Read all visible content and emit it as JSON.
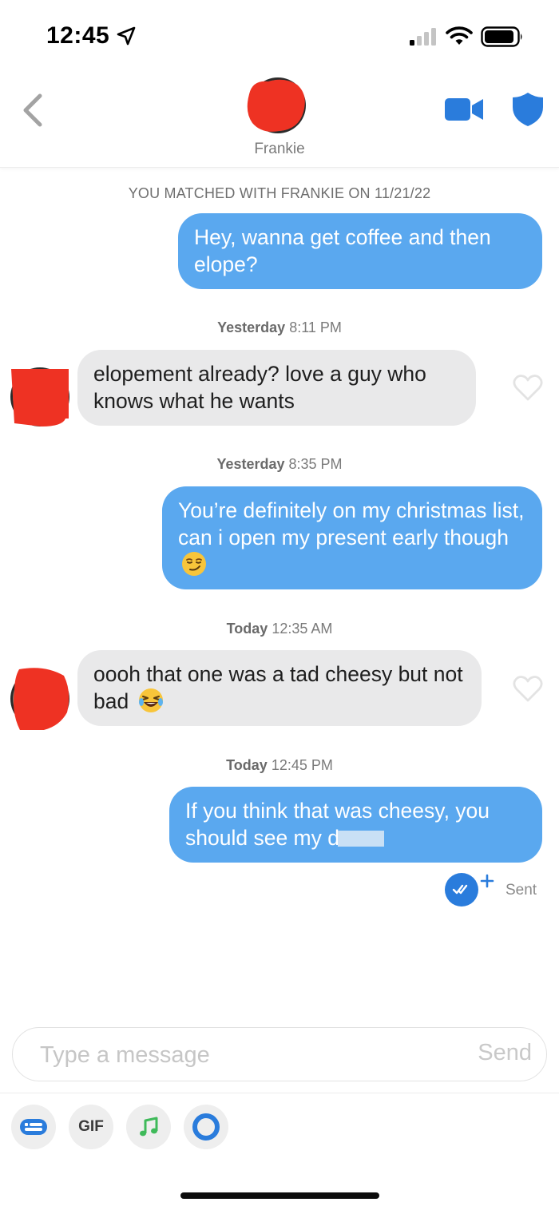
{
  "status_bar": {
    "time": "12:45",
    "icons": [
      "location-arrow-icon",
      "cellular-signal-icon",
      "wifi-icon",
      "battery-icon"
    ]
  },
  "header": {
    "contact_name": "Frankie",
    "icons": [
      "back-chevron-icon",
      "video-camera-icon",
      "shield-icon"
    ],
    "accent_color": "#2a7cdc"
  },
  "conversation": {
    "match_label": "YOU MATCHED WITH FRANKIE ON 11/21/22",
    "timestamps": [
      {
        "day": "Yesterday",
        "time": "8:11 PM"
      },
      {
        "day": "Yesterday",
        "time": "8:35 PM"
      },
      {
        "day": "Today",
        "time": "12:35 AM"
      },
      {
        "day": "Today",
        "time": "12:45 PM"
      }
    ],
    "messages": [
      {
        "direction": "outgoing",
        "text": "Hey, wanna get coffee and then elope?"
      },
      {
        "direction": "incoming",
        "text": "elopement already? love a guy who knows what he wants"
      },
      {
        "direction": "outgoing",
        "text": "You’re definitely on my christmas list, can i open my present early though",
        "emoji": "smirking-face-emoji"
      },
      {
        "direction": "incoming",
        "text": "oooh that one was a tad cheesy but not bad",
        "emoji": "laughing-face-emoji"
      },
      {
        "direction": "outgoing",
        "text": "If you think that was cheesy, you should see my d"
      }
    ],
    "delivery_status": "Sent",
    "outgoing_bubble_color": "#5aa8ef",
    "incoming_bubble_color": "#e9e9ea"
  },
  "composer": {
    "placeholder": "Type a message",
    "send_label": "Send",
    "tools": [
      {
        "name": "sticker-icon"
      },
      {
        "name": "gif",
        "label": "GIF"
      },
      {
        "name": "music-note-icon"
      },
      {
        "name": "circle-icon"
      }
    ]
  }
}
